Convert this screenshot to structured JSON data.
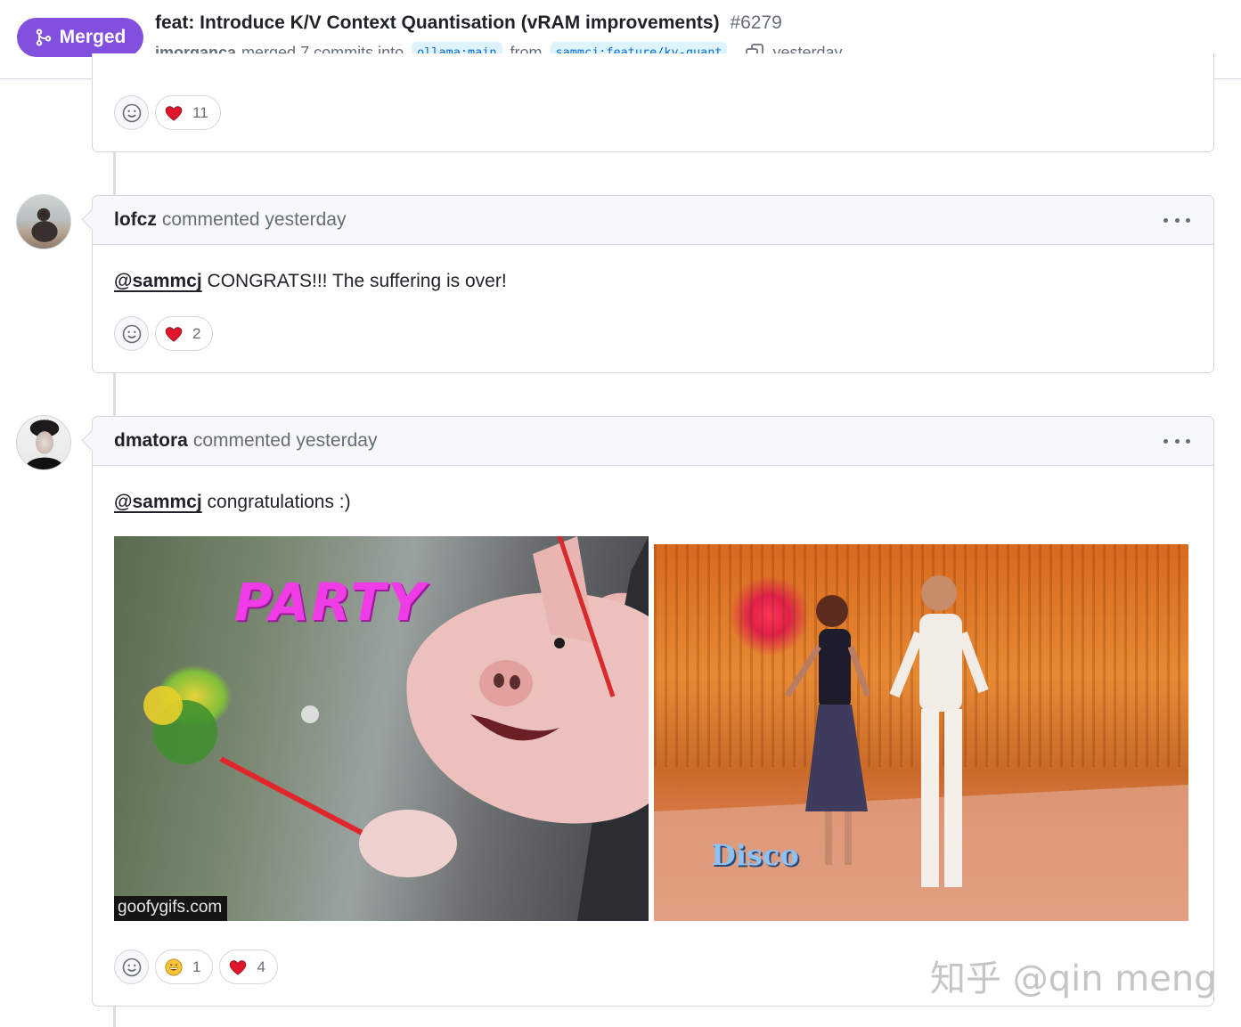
{
  "header": {
    "status_badge": "Merged",
    "title": "feat: Introduce K/V Context Quantisation (vRAM improvements)",
    "number": "#6279",
    "author": "jmorganca",
    "merge_text": "merged 7 commits into",
    "base_branch": "ollama:main",
    "from_text": "from",
    "head_branch": "sammcj:feature/kv-quant",
    "time": "yesterday"
  },
  "previous_comment": {
    "reactions": [
      {
        "emoji": "heart",
        "count": "11"
      }
    ]
  },
  "comments": [
    {
      "author": "lofcz",
      "action": "commented yesterday",
      "mention": "@sammcj",
      "text": " CONGRATS!!! The suffering is over!",
      "reactions": [
        {
          "emoji": "heart",
          "count": "2"
        }
      ]
    },
    {
      "author": "dmatora",
      "action": "commented yesterday",
      "mention": "@sammcj",
      "text": " congratulations :)",
      "gifs": {
        "pig_caption": "PARTY",
        "pig_credit": "goofygifs.com",
        "disco_caption": "Disco"
      },
      "reactions": [
        {
          "emoji": "grinning",
          "count": "1"
        },
        {
          "emoji": "heart",
          "count": "4"
        }
      ]
    }
  ],
  "watermark": "知乎 @qin meng",
  "colors": {
    "merged": "#8250df",
    "branch_text": "#0969da",
    "branch_bg": "#ddf4ff",
    "heart": "#e0152b"
  }
}
